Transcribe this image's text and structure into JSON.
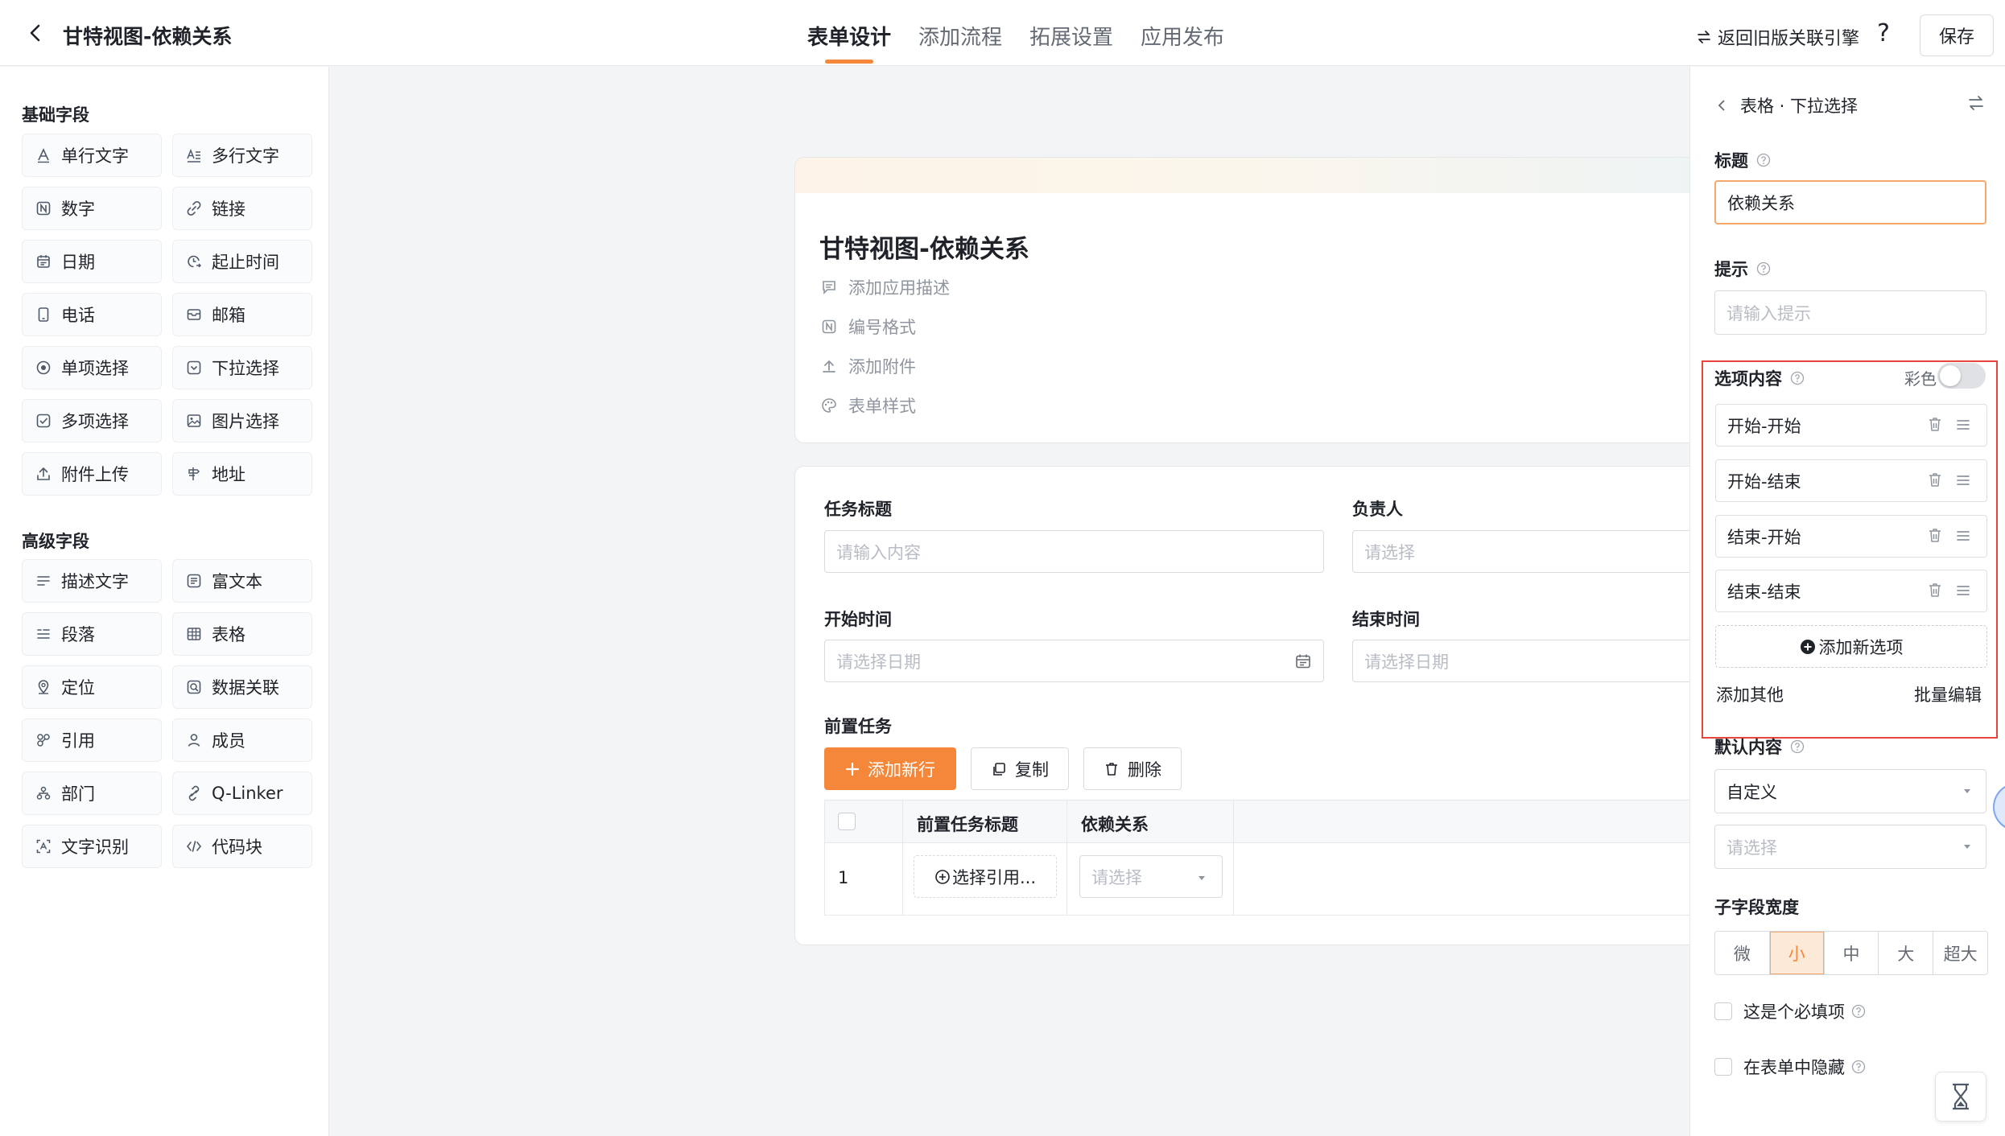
{
  "header": {
    "title": "甘特视图-依赖关系",
    "tabs": [
      "表单设计",
      "添加流程",
      "拓展设置",
      "应用发布"
    ],
    "old_link": "返回旧版关联引擎",
    "help": "?",
    "save": "保存"
  },
  "left": {
    "basic_title": "基础字段",
    "basic_fields": [
      {
        "label": "单行文字",
        "icon": "text-icon"
      },
      {
        "label": "多行文字",
        "icon": "multiline-text-icon"
      },
      {
        "label": "数字",
        "icon": "number-icon"
      },
      {
        "label": "链接",
        "icon": "link-icon"
      },
      {
        "label": "日期",
        "icon": "calendar-icon"
      },
      {
        "label": "起止时间",
        "icon": "time-range-icon"
      },
      {
        "label": "电话",
        "icon": "phone-icon"
      },
      {
        "label": "邮箱",
        "icon": "mail-icon"
      },
      {
        "label": "单项选择",
        "icon": "radio-icon"
      },
      {
        "label": "下拉选择",
        "icon": "dropdown-icon"
      },
      {
        "label": "多项选择",
        "icon": "checkbox-icon"
      },
      {
        "label": "图片选择",
        "icon": "image-icon"
      },
      {
        "label": "附件上传",
        "icon": "upload-icon"
      },
      {
        "label": "地址",
        "icon": "address-icon"
      }
    ],
    "advanced_title": "高级字段",
    "advanced_fields": [
      {
        "label": "描述文字",
        "icon": "description-icon"
      },
      {
        "label": "富文本",
        "icon": "rich-text-icon"
      },
      {
        "label": "段落",
        "icon": "paragraph-icon"
      },
      {
        "label": "表格",
        "icon": "table-icon"
      },
      {
        "label": "定位",
        "icon": "location-icon"
      },
      {
        "label": "数据关联",
        "icon": "data-link-icon"
      },
      {
        "label": "引用",
        "icon": "reference-icon"
      },
      {
        "label": "成员",
        "icon": "member-icon"
      },
      {
        "label": "部门",
        "icon": "department-icon"
      },
      {
        "label": "Q-Linker",
        "icon": "qlinker-icon"
      },
      {
        "label": "文字识别",
        "icon": "ocr-icon"
      },
      {
        "label": "代码块",
        "icon": "code-icon"
      }
    ]
  },
  "center": {
    "form_title": "甘特视图-依赖关系",
    "meta": [
      "添加应用描述",
      "编号格式",
      "添加附件",
      "表单样式"
    ],
    "fields": {
      "task_title_label": "任务标题",
      "task_title_placeholder": "请输入内容",
      "owner_label": "负责人",
      "owner_placeholder": "请选择",
      "start_label": "开始时间",
      "start_placeholder": "请选择日期",
      "end_label": "结束时间",
      "end_placeholder": "请选择日期",
      "pre_label": "前置任务"
    },
    "buttons": {
      "add_row": "添加新行",
      "copy": "复制",
      "delete": "删除"
    },
    "table": {
      "headers": [
        "前置任务标题",
        "依赖关系"
      ],
      "row_index": "1",
      "select_ref": "选择引用...",
      "dep_placeholder": "请选择"
    }
  },
  "right": {
    "breadcrumb": "表格 · 下拉选择",
    "title_label": "标题",
    "title_value": "依赖关系",
    "hint_label": "提示",
    "hint_placeholder": "请输入提示",
    "options_label": "选项内容",
    "color_label": "彩色",
    "color_enabled": false,
    "options": [
      "开始-开始",
      "开始-结束",
      "结束-开始",
      "结束-结束"
    ],
    "add_option": "添加新选项",
    "add_other": "添加其他",
    "batch_edit": "批量编辑",
    "default_label": "默认内容",
    "default_mode": "自定义",
    "default_placeholder": "请选择",
    "width_label": "子字段宽度",
    "widths": [
      "微",
      "小",
      "中",
      "大",
      "超大"
    ],
    "width_selected": "小",
    "required_label": "这是个必填项",
    "hidden_label": "在表单中隐藏"
  },
  "colors": {
    "accent": "#f5873a",
    "highlight_border": "#e8453c"
  }
}
